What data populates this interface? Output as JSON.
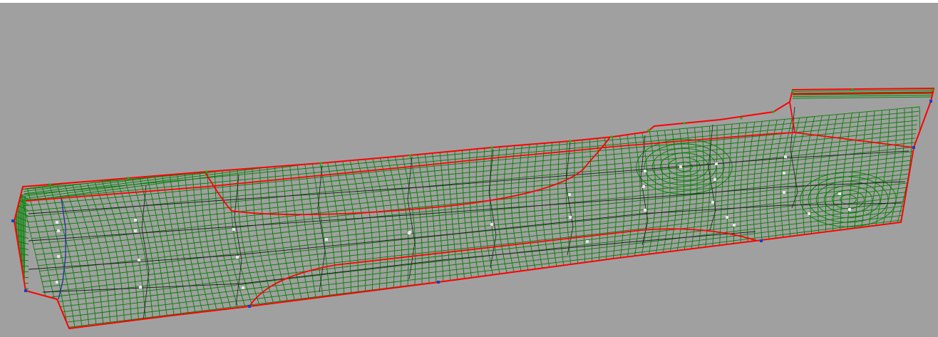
{
  "view": {
    "background_color": "#a0a0a0",
    "top_strip_color": "#ffffff"
  },
  "mesh": {
    "boundary_color": "#ff0000",
    "grid_color": "#008000",
    "feature_line_color": "#1a1a1a",
    "flow_line_color": "#2a2aa0",
    "vertex_marker_color": "#e6e6e6",
    "boundary_node_color": "#00c000",
    "corner_node_color": "#1040d0"
  }
}
